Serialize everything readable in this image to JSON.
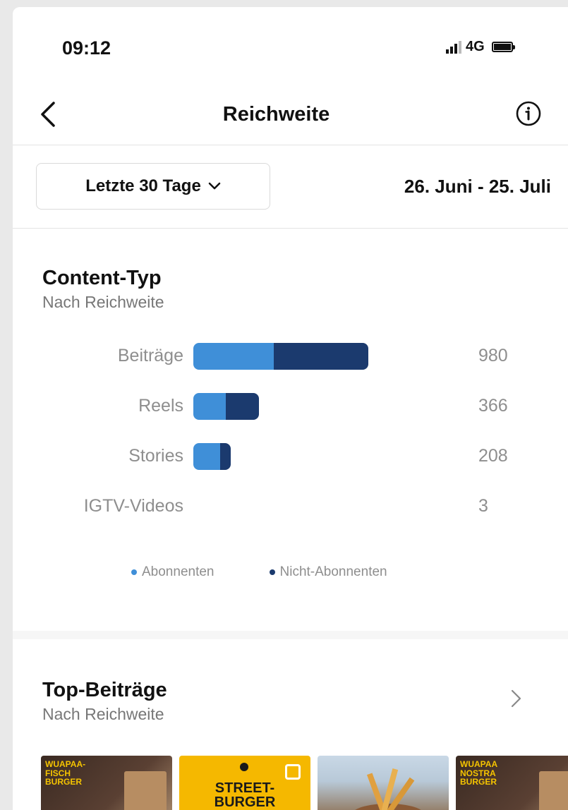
{
  "status_bar": {
    "time": "09:12",
    "network": "4G"
  },
  "header": {
    "title": "Reichweite"
  },
  "filter": {
    "range_label": "Letzte 30 Tage",
    "date_range": "26. Juni - 25. Juli"
  },
  "content_type": {
    "title": "Content-Typ",
    "subtitle": "Nach Reichweite"
  },
  "chart_data": {
    "type": "bar",
    "orientation": "horizontal",
    "stacked": true,
    "categories": [
      "Beiträge",
      "Reels",
      "Stories",
      "IGTV-Videos"
    ],
    "totals": [
      "980",
      "366",
      "208",
      "3"
    ],
    "series": [
      {
        "name": "Abonnenten",
        "values": [
          450,
          180,
          150,
          2
        ],
        "color": "#3f8fd8"
      },
      {
        "name": "Nicht-Abonnenten",
        "values": [
          530,
          186,
          58,
          1
        ],
        "color": "#1b3a6e"
      }
    ],
    "xlim": [
      0,
      980
    ],
    "legend_position": "bottom"
  },
  "top_posts": {
    "title": "Top-Beiträge",
    "subtitle": "Nach Reichweite",
    "thumbnails": [
      {
        "text": "WUAPAA-\nFISCH\nBURGER"
      },
      {
        "text": "STREET-\nBURGER"
      },
      {
        "text": ""
      },
      {
        "text": "WUAPAA\nNOSTRA\nBURGER"
      }
    ]
  },
  "colors": {
    "accent_light": "#3f8fd8",
    "accent_dark": "#1b3a6e",
    "muted_text": "#8e8e8e"
  }
}
